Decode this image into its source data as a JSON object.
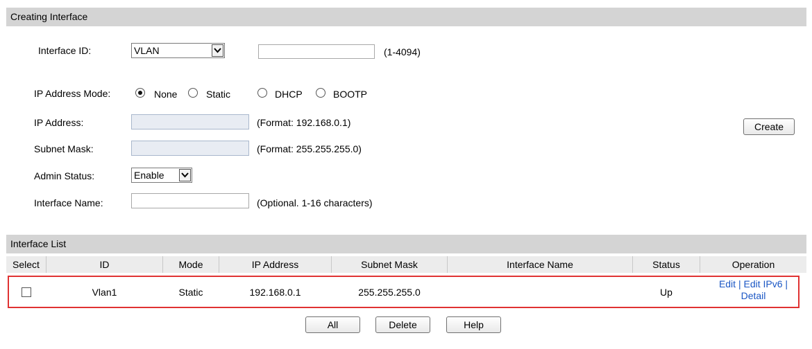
{
  "create": {
    "section_title": "Creating Interface",
    "interface_id_label": "Interface ID:",
    "interface_type": "VLAN",
    "interface_id_value": "",
    "interface_id_range": "(1-4094)",
    "ip_mode_label": "IP Address Mode:",
    "ip_modes": [
      "None",
      "Static",
      "DHCP",
      "BOOTP"
    ],
    "ip_mode_selected": "None",
    "ip_address_label": "IP Address:",
    "ip_address_value": "",
    "ip_address_hint": "(Format: 192.168.0.1)",
    "subnet_mask_label": "Subnet Mask:",
    "subnet_mask_value": "",
    "subnet_mask_hint": "(Format: 255.255.255.0)",
    "admin_status_label": "Admin Status:",
    "admin_status_value": "Enable",
    "interface_name_label": "Interface Name:",
    "interface_name_value": "",
    "interface_name_hint": "(Optional. 1-16 characters)",
    "create_button": "Create"
  },
  "list": {
    "section_title": "Interface List",
    "columns": [
      "Select",
      "ID",
      "Mode",
      "IP Address",
      "Subnet Mask",
      "Interface Name",
      "Status",
      "Operation"
    ],
    "rows": [
      {
        "id": "Vlan1",
        "mode": "Static",
        "ip_address": "192.168.0.1",
        "subnet_mask": "255.255.255.0",
        "interface_name": "",
        "status": "Up",
        "op_edit": "Edit",
        "op_edit_ipv6": "Edit IPv6",
        "op_detail": "Detail",
        "op_sep": "|"
      }
    ]
  },
  "buttons": {
    "all": "All",
    "delete": "Delete",
    "help": "Help"
  },
  "colors": {
    "section_bar": "#d4d4d4",
    "link": "#1a56c4",
    "highlight": "#e03232"
  }
}
